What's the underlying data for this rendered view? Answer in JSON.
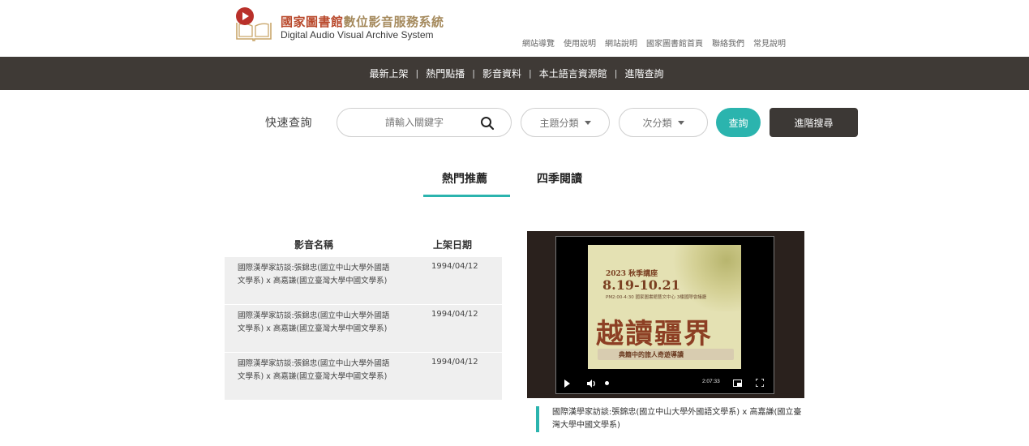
{
  "header": {
    "logo_zh_red": "國家圖書館",
    "logo_zh_rest": "數位影音服務系統",
    "logo_en": "Digital Audio Visual Archive System",
    "top_links": [
      "網站導覽",
      "使用說明",
      "網站說明",
      "國家圖書館首頁",
      "聯絡我們",
      "常見說明"
    ]
  },
  "nav": {
    "items": [
      "最新上架",
      "熱門點播",
      "影音資料",
      "本土語言資源館",
      "進階查詢"
    ],
    "separator": "|"
  },
  "search": {
    "label": "快速查詢",
    "placeholder": "請輸入關鍵字",
    "category_label": "主題分類",
    "subcategory_label": "次分類",
    "query_button": "查詢",
    "advanced_button": "進階搜尋"
  },
  "tabs": {
    "hot": "熱門推薦",
    "season": "四季閱讀",
    "active": "hot"
  },
  "table": {
    "col_name": "影音名稱",
    "col_date": "上架日期",
    "rows": [
      {
        "name": "國際漢學家訪談:張錦忠(國立中山大學外國語文學系) x 高嘉謙(國立臺灣大學中國文學系)",
        "date": "1994/04/12"
      },
      {
        "name": "國際漢學家訪談:張錦忠(國立中山大學外國語文學系) x 高嘉謙(國立臺灣大學中國文學系)",
        "date": "1994/04/12"
      },
      {
        "name": "國際漢學家訪談:張錦忠(國立中山大學外國語文學系) x 高嘉謙(國立臺灣大學中國文學系)",
        "date": "1994/04/12"
      }
    ]
  },
  "video": {
    "poster_year": "2023 秋季講座",
    "poster_dates": "8.19-10.21",
    "poster_time": "PM2:00-4:30 國家圖書館藝文中心 3樓國際會議廳",
    "poster_title": "越讀疆界",
    "poster_subtitle": "典籍中的旅人奇遊導讀",
    "duration": "2:07:33",
    "caption": "國際漢學家訪談:張錦忠(國立中山大學外國語文學系) x 高嘉謙(國立臺灣大學中國文學系)"
  },
  "colors": {
    "accent": "#2bb4ae",
    "nav_bg": "#3f3a36",
    "brand_red": "#b9492c",
    "brand_gold": "#a58a5d"
  }
}
